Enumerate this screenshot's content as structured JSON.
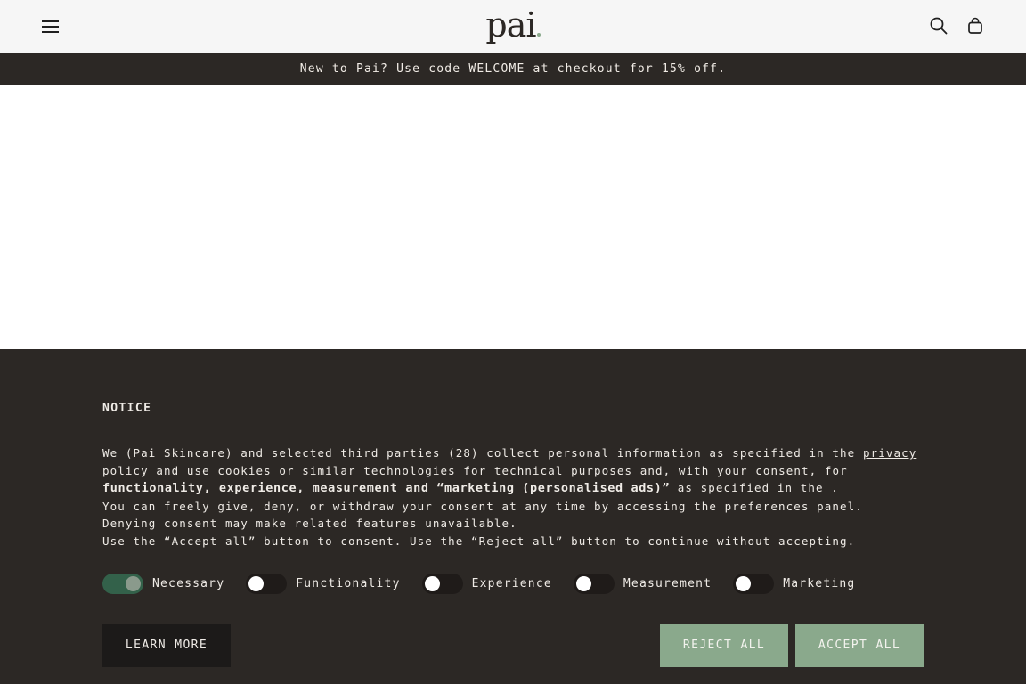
{
  "header": {
    "logo_text": "pai",
    "menu_icon": "hamburger-icon",
    "search_icon": "search-icon",
    "cart_icon": "bag-icon"
  },
  "promo": {
    "text": "New to Pai? Use code WELCOME at checkout for 15% off."
  },
  "cookie_notice": {
    "title": "NOTICE",
    "body_line1_prefix": "We (Pai Skincare) and selected third parties (28) collect personal information as specified in the ",
    "privacy_link": "privacy policy",
    "body_line1_suffix": " and use cookies or similar technologies for technical purposes and, with your consent, for ",
    "bold_purposes": "functionality, experience, measurement and “marketing (personalised ads)”",
    "body_line2_suffix": " as specified in the .",
    "body_line3": "You can freely give, deny, or withdraw your consent at any time by accessing the preferences panel.",
    "body_line4": "Denying consent may make related features unavailable.",
    "body_line5": "Use the “Accept all” button to consent. Use the “Reject all” button to continue without accepting.",
    "toggles": [
      {
        "label": "Necessary",
        "on": true
      },
      {
        "label": "Functionality",
        "on": false
      },
      {
        "label": "Experience",
        "on": false
      },
      {
        "label": "Measurement",
        "on": false
      },
      {
        "label": "Marketing",
        "on": false
      }
    ],
    "learn_more_label": "LEARN MORE",
    "reject_label": "REJECT ALL",
    "accept_label": "ACCEPT ALL"
  },
  "colors": {
    "dark": "#2c2825",
    "accent_green": "#8aa98c",
    "toggle_on": "#33614a"
  }
}
